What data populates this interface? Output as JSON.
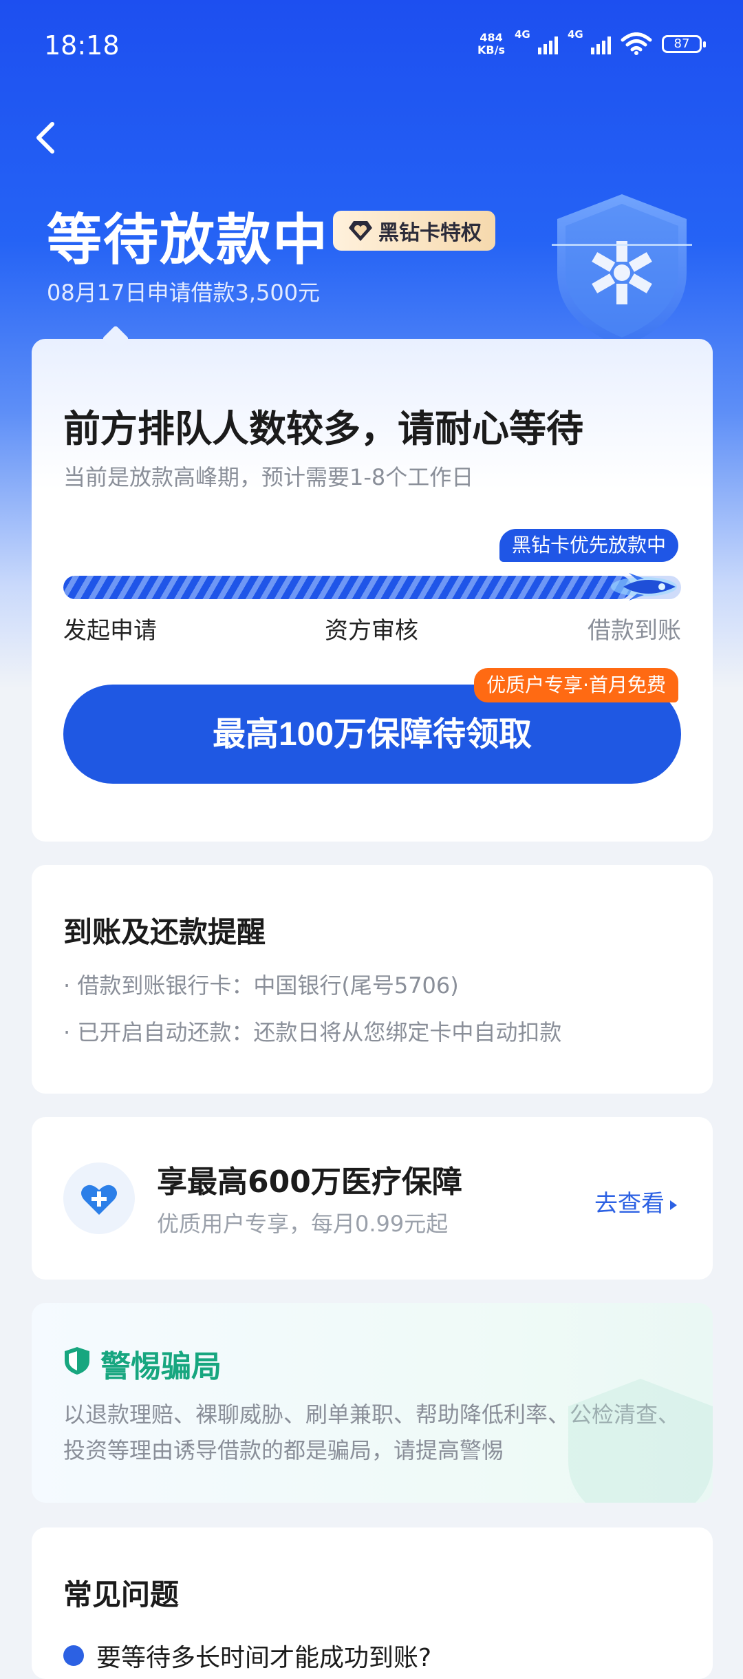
{
  "status_bar": {
    "time": "18:18",
    "net_speed_top": "484",
    "net_speed_unit": "KB/s",
    "sim1_tech": "4G",
    "sim2_tech": "4G",
    "battery": "87"
  },
  "header": {
    "back_icon": "chevron-left-icon",
    "title": "等待放款中",
    "badge": "黑钻卡特权",
    "subtitle": "08月17日申请借款3,500元"
  },
  "status_card": {
    "headline": "前方排队人数较多，请耐心等待",
    "description": "当前是放款高峰期，预计需要1-8个工作日",
    "priority_tag": "黑钻卡优先放款中",
    "progress_fraction": 0.92,
    "steps": [
      "发起申请",
      "资方审核",
      "借款到账"
    ],
    "cta_label": "最高100万保障待领取",
    "cta_tag": "优质户专享·首月免费"
  },
  "reminder_card": {
    "title": "到账及还款提醒",
    "items": [
      "· 借款到账银行卡：中国银行(尾号5706)",
      "· 已开启自动还款：还款日将从您绑定卡中自动扣款"
    ]
  },
  "insurance_card": {
    "title": "享最高600万医疗保障",
    "subtitle": "优质用户专享，每月0.99元起",
    "link": "去查看"
  },
  "fraud_card": {
    "title": "警惕骗局",
    "text": "以退款理赔、裸聊威胁、刷单兼职、帮助降低利率、公检清查、投资等理由诱导借款的都是骗局，请提高警惕"
  },
  "faq_card": {
    "title": "常见问题",
    "first_item": "要等待多长时间才能成功到账?"
  },
  "colors": {
    "brand_blue": "#1f58e3",
    "orange": "#ff6a13",
    "fraud_green": "#17a67f"
  }
}
